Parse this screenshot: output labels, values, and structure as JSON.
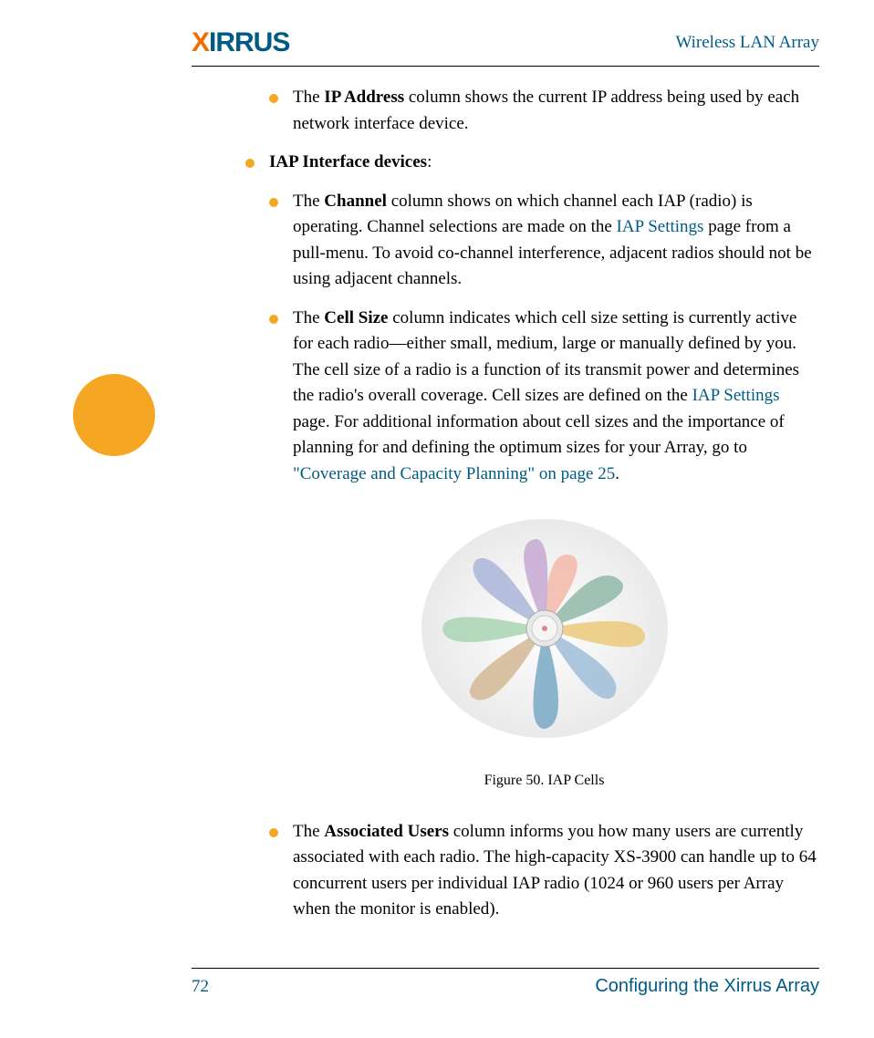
{
  "header": {
    "logo_x": "X",
    "logo_rest": "IRRUS",
    "title": "Wireless LAN Array"
  },
  "content": {
    "item1": {
      "prefix": "The ",
      "bold": "IP Address",
      "rest": " column shows the current IP address being used by each network interface device."
    },
    "item2": {
      "bold": "IAP Interface devices",
      "rest": ":"
    },
    "item3": {
      "prefix": "The ",
      "bold": "Channel",
      "rest1": " column shows on which channel each IAP (radio) is operating. Channel selections are made on the ",
      "link1": "IAP Settings",
      "rest2": " page from a pull-menu. To avoid co-channel interference, adjacent radios should not be using adjacent channels."
    },
    "item4": {
      "prefix": "The ",
      "bold": "Cell Size",
      "rest1": " column indicates which cell size setting is currently active for each radio—either small, medium, large or manually defined by you. The cell size of a radio is a function of its transmit power and determines the radio's overall coverage. Cell sizes are defined on the ",
      "link1": "IAP Settings",
      "rest2": " page. For additional information about cell sizes and the importance of planning for and defining the optimum sizes for your Array, go to ",
      "link2": "\"Coverage and Capacity Planning\" on page 25",
      "rest3": "."
    },
    "figure_caption": "Figure 50. IAP Cells",
    "item5": {
      "prefix": "The ",
      "bold": "Associated Users",
      "rest": " column informs you how many users are currently associated with each radio. The high-capacity XS-3900 can handle up to 64 concurrent users per individual IAP radio (1024 or 960 users per Array when the monitor is enabled)."
    }
  },
  "footer": {
    "page_number": "72",
    "text": "Configuring the Xirrus Array"
  }
}
